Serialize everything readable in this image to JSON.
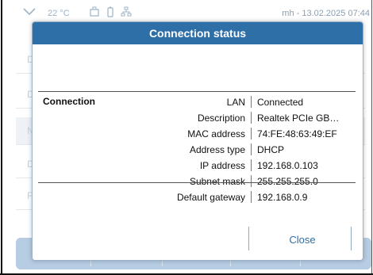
{
  "statusbar": {
    "temperature": "22 °C",
    "datetime": "mh - 13.02.2025 07:44",
    "icons": [
      "chevron-down-icon",
      "device-icon",
      "battery-icon",
      "network-icon"
    ]
  },
  "background": {
    "row_letters": [
      "D",
      "D",
      "N",
      "D",
      "F"
    ]
  },
  "modal": {
    "title": "Connection status",
    "section_label": "Connection",
    "rows": [
      {
        "key": "LAN",
        "value": "Connected"
      },
      {
        "key": "Description",
        "value": "Realtek PCIe GB…"
      },
      {
        "key": "MAC address",
        "value": "74:FE:48:63:49:EF"
      },
      {
        "key": "Address type",
        "value": "DHCP"
      },
      {
        "key": "IP address",
        "value": "192.168.0.103"
      },
      {
        "key": "Subnet mask",
        "value": "255.255.255.0"
      },
      {
        "key": "Default gateway",
        "value": "192.168.0.9"
      }
    ],
    "close_label": "Close"
  },
  "colors": {
    "title_bar": "#2f6fa8",
    "close_text": "#2f6fa8",
    "bottom_bar": "#b7cde3"
  }
}
